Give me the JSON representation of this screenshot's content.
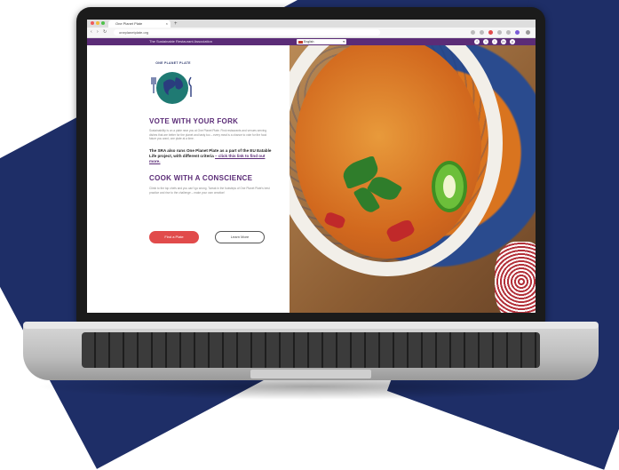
{
  "browser": {
    "tab_title": "One Planet Plate",
    "tab_close": "×",
    "new_tab": "+",
    "back": "‹",
    "forward": "›",
    "reload": "↻",
    "url": "oneplanetplate.org"
  },
  "site_bar": {
    "tagline": "The Sustainable Restaurant Association",
    "language": "English",
    "language_caret": "▾",
    "social": [
      "f",
      "t",
      "i",
      "in",
      "y"
    ]
  },
  "logo": {
    "text": "ONE PLANET PLATE"
  },
  "hero": {
    "heading1": "VOTE WITH YOUR FORK",
    "para1": "Sustainability is on a plate near you at One Planet Plate. Find restaurants and venues serving dishes that are better for the planet and tasty too – every meal is a chance to vote for the food future you want, one plate at a time.",
    "bold_text": "The SRA also runs One Planet Plate as a part of the EU Eatable Life project, with different criteria",
    "bold_link": "– click this link to find out more.",
    "heading2": "COOK WITH A CONSCIENCE",
    "para2": "Climb to the top chefs and you can't go wrong. Tweak in the footsteps of One Planet Plate's best practice and rise to the challenge – make your own creation!",
    "primary_button": "Find a Plate",
    "secondary_button": "Learn More"
  },
  "colors": {
    "purple": "#5b2c77",
    "accent_red": "#e14b4b",
    "navy_background": "#1e2e67"
  }
}
